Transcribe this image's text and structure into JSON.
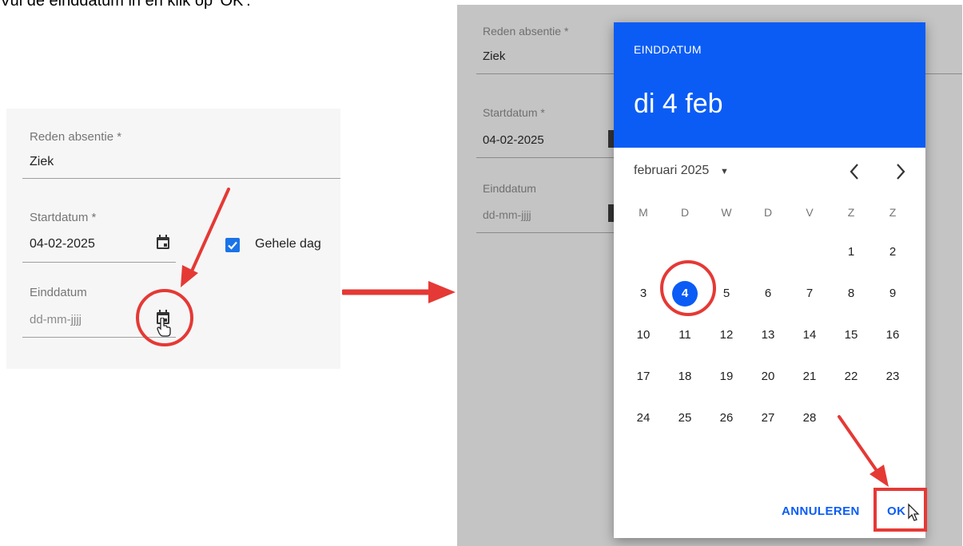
{
  "caption": "Vul de einddatum in en klik op 'OK'.",
  "form": {
    "reason_label": "Reden absentie *",
    "reason_value": "Ziek",
    "start_label": "Startdatum *",
    "start_value": "04-02-2025",
    "end_label": "Einddatum",
    "end_placeholder": "dd-mm-jjjj",
    "fullday_label": "Gehele dag",
    "fullday_checked": true
  },
  "datepicker": {
    "header_title": "EINDDATUM",
    "header_date": "di 4 feb",
    "month_label": "februari 2025",
    "weekdays": [
      "M",
      "D",
      "W",
      "D",
      "V",
      "Z",
      "Z"
    ],
    "weeks": [
      [
        "",
        "",
        "",
        "",
        "",
        "1",
        "2"
      ],
      [
        "3",
        "4",
        "5",
        "6",
        "7",
        "8",
        "9"
      ],
      [
        "10",
        "11",
        "12",
        "13",
        "14",
        "15",
        "16"
      ],
      [
        "17",
        "18",
        "19",
        "20",
        "21",
        "22",
        "23"
      ],
      [
        "24",
        "25",
        "26",
        "27",
        "28",
        "",
        ""
      ]
    ],
    "selected_day": "4",
    "cancel_label": "ANNULEREN",
    "ok_label": "OK"
  },
  "colors": {
    "accent": "#0a5cf5",
    "annotation": "#e53935",
    "backdrop": "#c4c4c4"
  },
  "icons": [
    "calendar-icon",
    "check-icon",
    "chevron-left-icon",
    "chevron-right-icon",
    "dropdown-caret-icon",
    "hand-cursor-icon",
    "pointer-cursor-icon",
    "arrow-icon"
  ]
}
